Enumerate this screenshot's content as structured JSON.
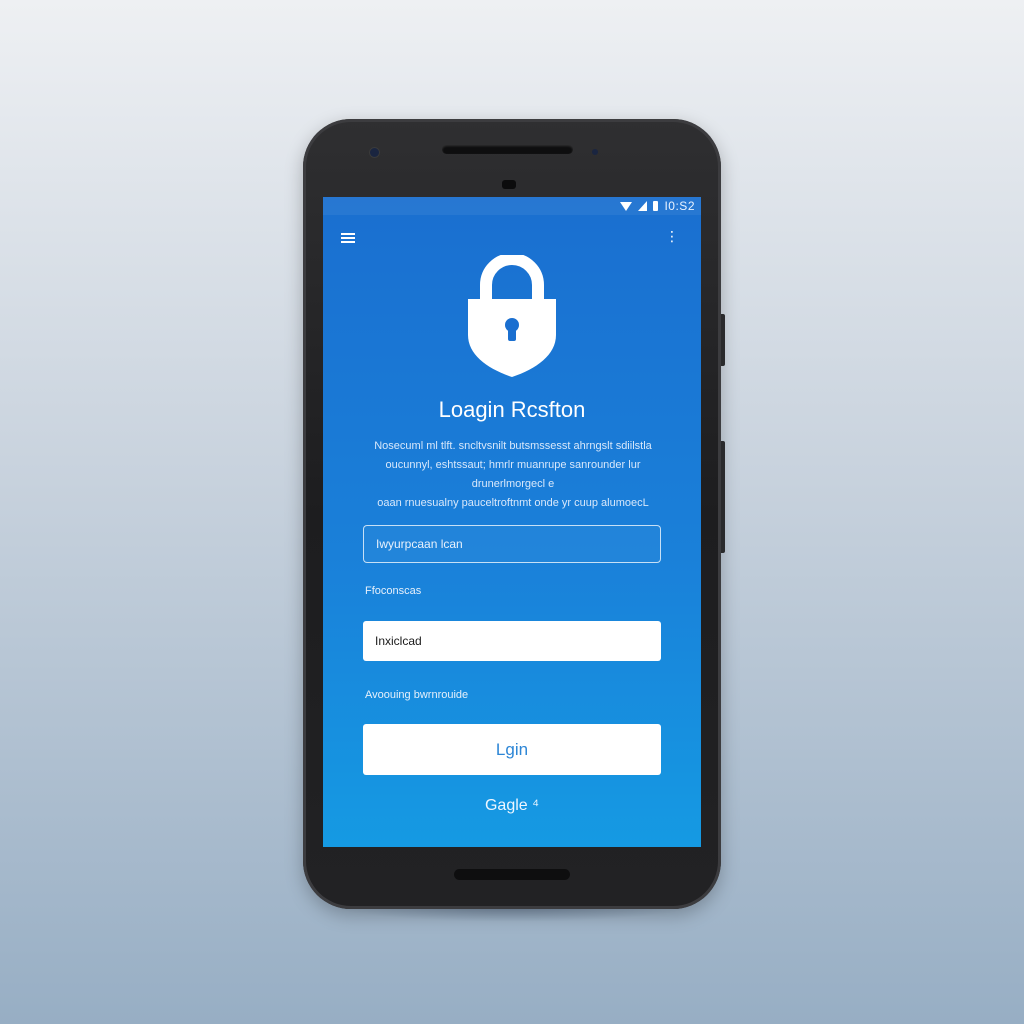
{
  "status_bar": {
    "time": "I0:S2"
  },
  "header": {
    "title": "Loagin Rcsfton"
  },
  "description": {
    "lines": [
      "Nosecuml ml tlft. sncltvsnilt butsmssesst ahrngslt sdiilstla",
      "oucunnyl, eshtssaut; hmrlr muanrupe sanrounder lur drunerlmorgecl e",
      "oaan rnuesualny pauceltroftnmt onde yr cuup alumoecL"
    ]
  },
  "form": {
    "username_placeholder": "Iwyurpcaan lcan",
    "password_label": "Ffoconscas",
    "password_value": "Inxiclcad",
    "forgot_label": "Avoouing bwrnrouide",
    "login_label": "Lgin",
    "google_label": "Gagle ⁴"
  },
  "colors": {
    "screen_top": "#1a6fd0",
    "screen_bottom": "#159ae3",
    "accent": "#2d86d6"
  },
  "icons": {
    "menu": "hamburger-menu-icon",
    "more": "more-vertical-icon",
    "lock": "lock-shield-icon",
    "signal": "signal-icon",
    "network": "network-icon",
    "battery": "battery-icon"
  }
}
